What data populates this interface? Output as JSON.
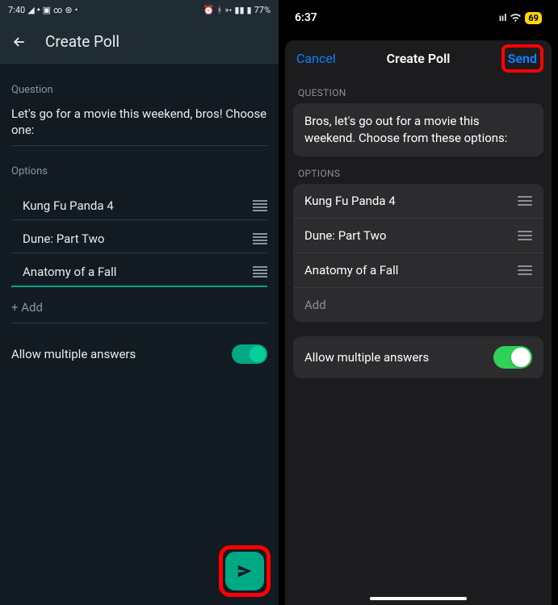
{
  "left": {
    "status": {
      "time": "7:40",
      "battery": "77%"
    },
    "header": {
      "title": "Create Poll"
    },
    "question_label": "Question",
    "question_text": "Let's go for a movie this weekend, bros! Choose one:",
    "options_label": "Options",
    "options": [
      "Kung Fu Panda 4",
      "Dune: Part Two",
      "Anatomy of a Fall"
    ],
    "add_label": "+ Add",
    "allow_label": "Allow multiple answers"
  },
  "right": {
    "status": {
      "time": "6:37",
      "battery": "69"
    },
    "header": {
      "cancel": "Cancel",
      "title": "Create Poll",
      "send": "Send"
    },
    "question_label": "QUESTION",
    "question_text": "Bros, let's go out for a movie this weekend. Choose from these options:",
    "options_label": "OPTIONS",
    "options": [
      "Kung Fu Panda 4",
      "Dune: Part Two",
      "Anatomy of a Fall"
    ],
    "add_label": "Add",
    "allow_label": "Allow multiple answers"
  }
}
